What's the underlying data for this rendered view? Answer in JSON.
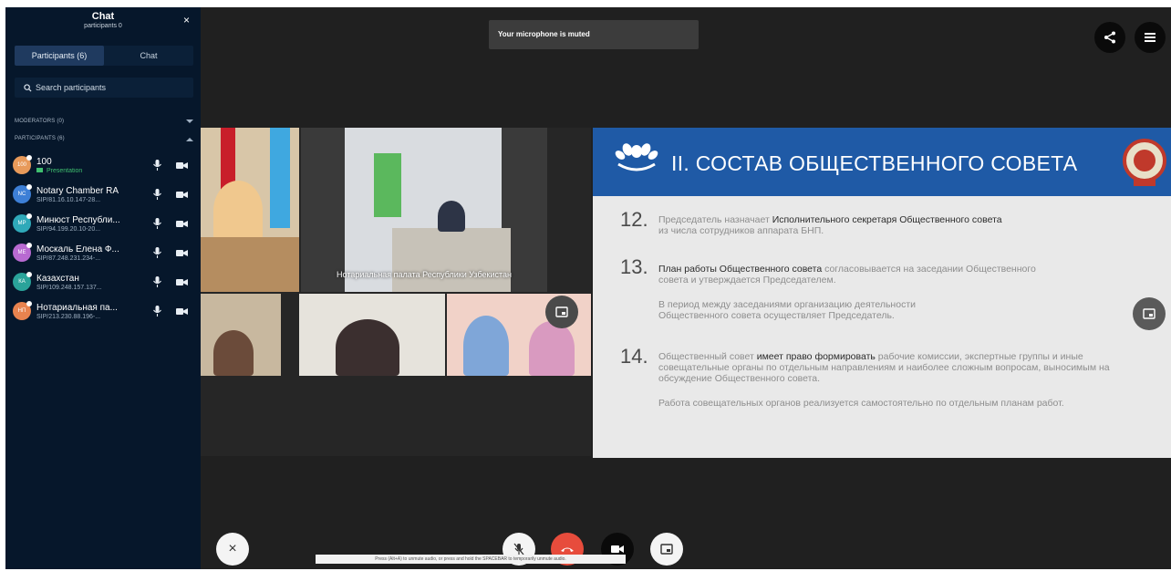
{
  "sidebar": {
    "title": "Chat",
    "subtitle": "participants 0",
    "close_glyph": "×",
    "tabs": [
      {
        "label": "Participants (6)",
        "active": true
      },
      {
        "label": "Chat",
        "active": false
      }
    ],
    "search": {
      "placeholder": "Search participants",
      "value": ""
    },
    "moderators_label": "MODERATORS (0)",
    "participants_label": "PARTICIPANTS (6)",
    "participants": [
      {
        "initials": "100",
        "name": "100",
        "subtitle": "Presentation",
        "color": "#e89a5a",
        "mic": "mic-icon",
        "video": "video-camera-icon"
      },
      {
        "initials": "NC",
        "name": "Notary Chamber RA",
        "subtitle": "SIP/81.16.10.147-28...",
        "color": "#3d7fd6",
        "mic": "mic-icon",
        "video": "video-camera-icon"
      },
      {
        "initials": "МР",
        "name": "Минюст Республи...",
        "subtitle": "SIP/94.199.20.10-20...",
        "color": "#2fa9b9",
        "mic": "mic-icon",
        "video": "video-camera-icon"
      },
      {
        "initials": "МЕ",
        "name": "Москаль Елена Ф...",
        "subtitle": "SIP/87.248.231.234-...",
        "color": "#b86ad1",
        "mic": "mic-icon",
        "video": "video-camera-icon"
      },
      {
        "initials": "КА",
        "name": "Казахстан",
        "subtitle": "SIP/109.248.157.137...",
        "color": "#2aa39a",
        "mic": "mic-icon",
        "video": "video-camera-icon"
      },
      {
        "initials": "НП",
        "name": "Нотариальная па...",
        "subtitle": "SIP/213.230.88.196-...",
        "color": "#e8834f",
        "mic": "mic-icon",
        "video": "video-camera-icon"
      }
    ]
  },
  "toast": {
    "text": "Your microphone is muted"
  },
  "video": {
    "tile_label": "Нотариальная палата Республики Узбекистан"
  },
  "slide": {
    "title": "II. СОСТАВ ОБЩЕСТВЕННОГО СОВЕТА",
    "items": [
      {
        "num": "12.",
        "text_before": "Председатель назначает ",
        "bold": "Исполнительного секретаря Общественного совета",
        "text_after": "из числа сотрудников аппарата БНП."
      },
      {
        "num": "13.",
        "text_before": "",
        "bold": "План работы Общественного совета",
        "text_after": " согласовывается на заседании Общественного совета и утверждается Председателем.",
        "para2": "В период между заседаниями организацию деятельности Общественного совета осуществляет Председатель."
      },
      {
        "num": "14.",
        "text_before": "Общественный совет ",
        "bold": "имеет право формировать",
        "text_after": " рабочие комиссии, экспертные группы и иные совещательные органы по отдельным направлениям и наиболее сложным вопросам, выносимым на обсуждение Общественного совета.",
        "para2": "Работа совещательных органов реализуется самостоятельно по отдельным планам работ."
      }
    ]
  },
  "controls": {
    "close_glyph": "×",
    "tooltip": "Press (Alt+A) to unmute audio, or press and hold the SPACEBAR to temporarily unmute audio."
  },
  "colors": {
    "sidebar_bg": "#06172b",
    "main_bg": "#202020",
    "hangup": "#e74c3c",
    "slide_blue": "#1f5aa6"
  }
}
